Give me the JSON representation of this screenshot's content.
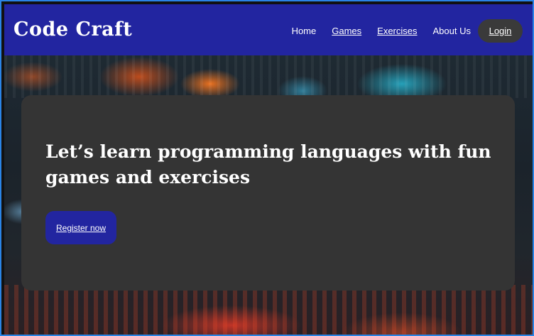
{
  "brand": {
    "name": "Code Craft"
  },
  "nav": {
    "links": [
      {
        "label": "Home",
        "underline": false
      },
      {
        "label": "Games",
        "underline": true
      },
      {
        "label": "Exercises",
        "underline": true
      },
      {
        "label": "About Us",
        "underline": false
      }
    ],
    "login_label": "Login"
  },
  "hero": {
    "headline": "Let’s learn programming languages with fun games and exercises",
    "cta_label": "Register now"
  },
  "colors": {
    "nav_bg": "#2225a0",
    "card_bg": "#343434",
    "button_bg": "#2225a0",
    "login_bg": "#3a3a3a",
    "frame_border": "#2a84e6"
  }
}
